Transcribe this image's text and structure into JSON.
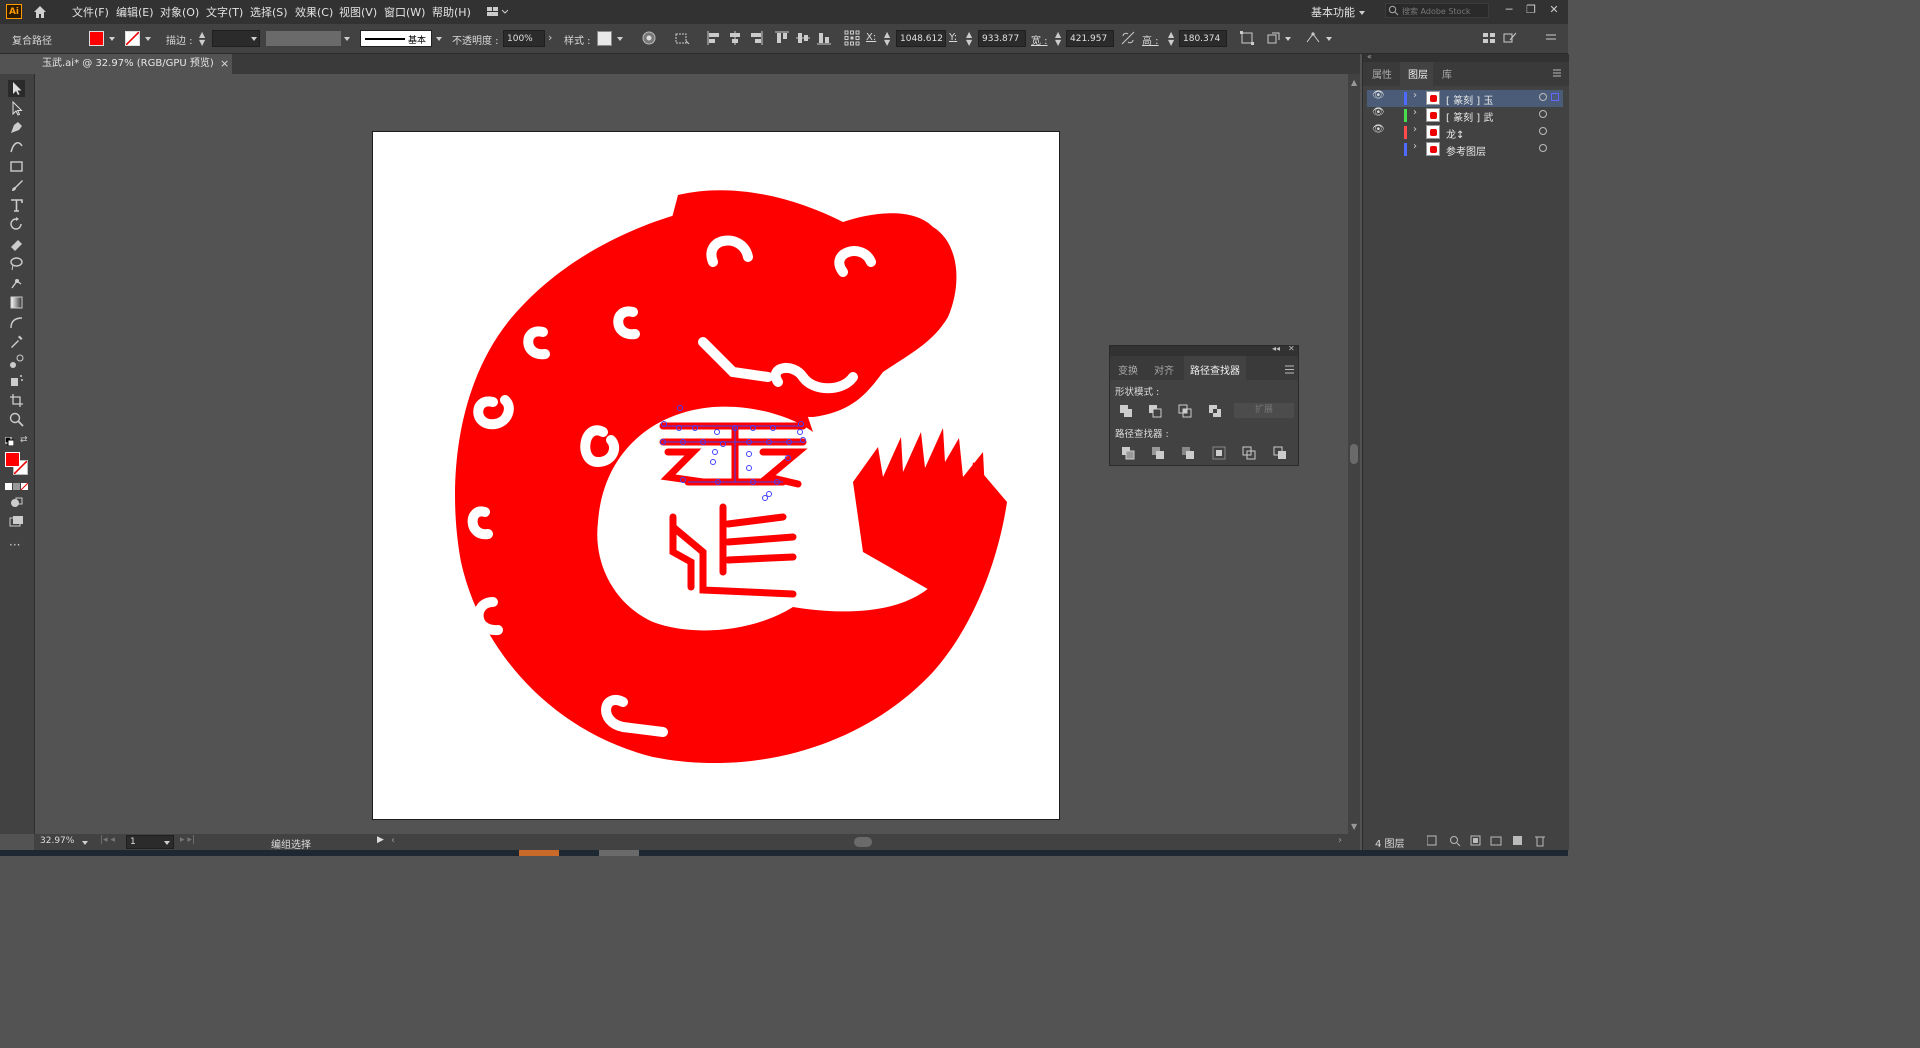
{
  "app": {
    "logo": "Ai"
  },
  "menu": [
    "文件(F)",
    "编辑(E)",
    "对象(O)",
    "文字(T)",
    "选择(S)",
    "效果(C)",
    "视图(V)",
    "窗口(W)",
    "帮助(H)"
  ],
  "workspace": {
    "label": "基本功能"
  },
  "search": {
    "placeholder": "搜索 Adobe Stock"
  },
  "control": {
    "selection_type": "复合路径",
    "fill_color": "#ff0000",
    "stroke_label": "描边 :",
    "stroke_profile": "基本",
    "opacity_label": "不透明度 :",
    "opacity_value": "100%",
    "style_label": "样式 :",
    "x_label": "X:",
    "x_value": "1048.612",
    "y_label": "Y:",
    "y_value": "933.877",
    "w_label": "宽 :",
    "w_value": "421.957",
    "h_label": "高 :",
    "h_value": "180.374"
  },
  "document_tab": {
    "title": "玉武.ai* @ 32.97% (RGB/GPU 预览)",
    "close": "×"
  },
  "statusbar": {
    "zoom": "32.97%",
    "artboard_num": "1",
    "status": "编组选择"
  },
  "layers_panel": {
    "tabs": [
      "属性",
      "图层",
      "库"
    ],
    "active_tab": "图层",
    "layers": [
      {
        "name": "[ 篆刻 ] 玉",
        "color": "#4f6bff",
        "visible": true,
        "selected": true
      },
      {
        "name": "[ 篆刻 ] 武",
        "color": "#4bdc4b",
        "visible": true,
        "selected": false
      },
      {
        "name": "龙↕",
        "color": "#ff4b4b",
        "visible": true,
        "selected": false
      },
      {
        "name": "参考图层",
        "color": "#4f6bff",
        "visible": false,
        "selected": false
      }
    ],
    "footer_count": "4 图层"
  },
  "pathfinder_panel": {
    "tabs": [
      "变换",
      "对齐",
      "路径查找器"
    ],
    "active_tab": "路径查找器",
    "shape_modes_label": "形状模式 :",
    "pathfinders_label": "路径查找器 :",
    "expand_label": "扩展"
  },
  "artwork": {
    "brand_color": "#ff0000",
    "anchor_color": "#4040ff"
  }
}
